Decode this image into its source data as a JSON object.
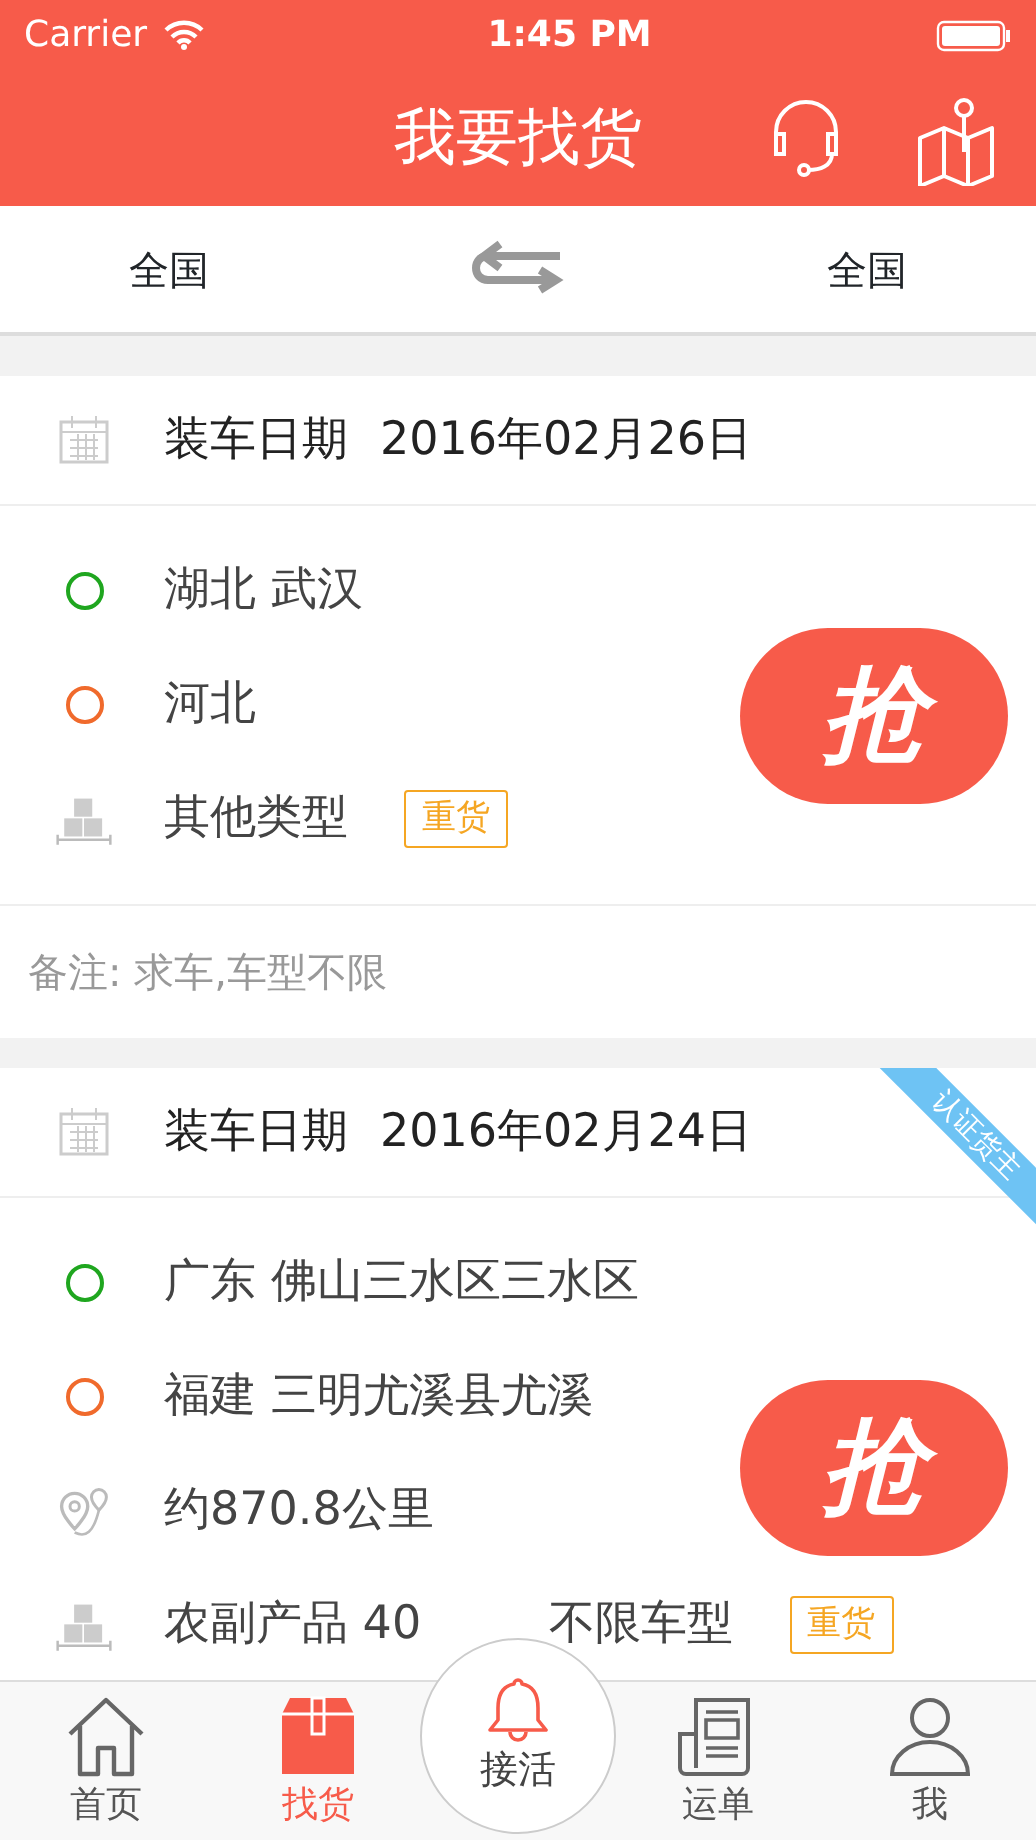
{
  "status_bar": {
    "carrier": "Carrier",
    "time": "1:45 PM"
  },
  "header": {
    "title": "我要找货"
  },
  "filter": {
    "from": "全国",
    "to": "全国"
  },
  "cards": [
    {
      "date_label": "装车日期",
      "date": "2016年02月26日",
      "grab": "抢",
      "rows": [
        {
          "kind": "origin",
          "texts": [
            "湖北 武汉"
          ]
        },
        {
          "kind": "destination",
          "texts": [
            "河北"
          ]
        },
        {
          "kind": "cargo",
          "texts": [
            "其他类型"
          ],
          "tag": "重货"
        }
      ],
      "note_label": "备注:",
      "note": "求车,车型不限"
    },
    {
      "date_label": "装车日期",
      "date": "2016年02月24日",
      "verified": "认证货主",
      "grab": "抢",
      "rows": [
        {
          "kind": "origin",
          "texts": [
            "广东 佛山三水区三水区"
          ]
        },
        {
          "kind": "destination",
          "texts": [
            "福建 三明尤溪县尤溪"
          ]
        },
        {
          "kind": "distance",
          "texts": [
            "约870.8公里"
          ]
        },
        {
          "kind": "cargo",
          "texts": [
            "农副产品 40",
            "不限车型"
          ],
          "tag": "重货"
        }
      ]
    }
  ],
  "tabs": [
    {
      "kind": "home",
      "label": "首页",
      "selected": false
    },
    {
      "kind": "goods",
      "label": "找货",
      "selected": true
    },
    {
      "kind": "center",
      "label": "接活",
      "selected": false
    },
    {
      "kind": "orders",
      "label": "运单",
      "selected": false
    },
    {
      "kind": "me",
      "label": "我",
      "selected": false
    }
  ]
}
